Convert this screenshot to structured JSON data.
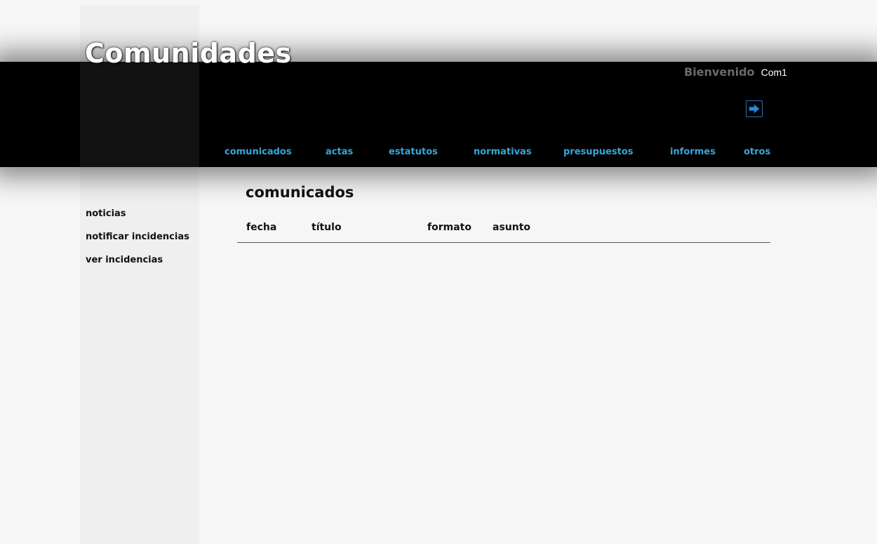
{
  "header": {
    "site_title": "Comunidades",
    "welcome_label": "Bienvenido",
    "username": "Com1",
    "logout_icon": "arrow-right-icon"
  },
  "topnav": {
    "items": [
      "comunicados",
      "actas",
      "estatutos",
      "normativas",
      "presupuestos",
      "informes",
      "otros"
    ]
  },
  "sidebar": {
    "items": [
      "noticias",
      "notificar incidencias",
      "ver incidencias"
    ]
  },
  "main": {
    "title": "comunicados",
    "table": {
      "columns": [
        "fecha",
        "título",
        "formato",
        "asunto"
      ],
      "rows": []
    }
  },
  "colors": {
    "page_background": "#f6f6f6",
    "sidebar_background": "#efefef",
    "header_background": "#000000",
    "nav_link": "#35a6d8",
    "welcome_label": "#6a6a6a",
    "logout_icon": "#2a6fb3"
  }
}
